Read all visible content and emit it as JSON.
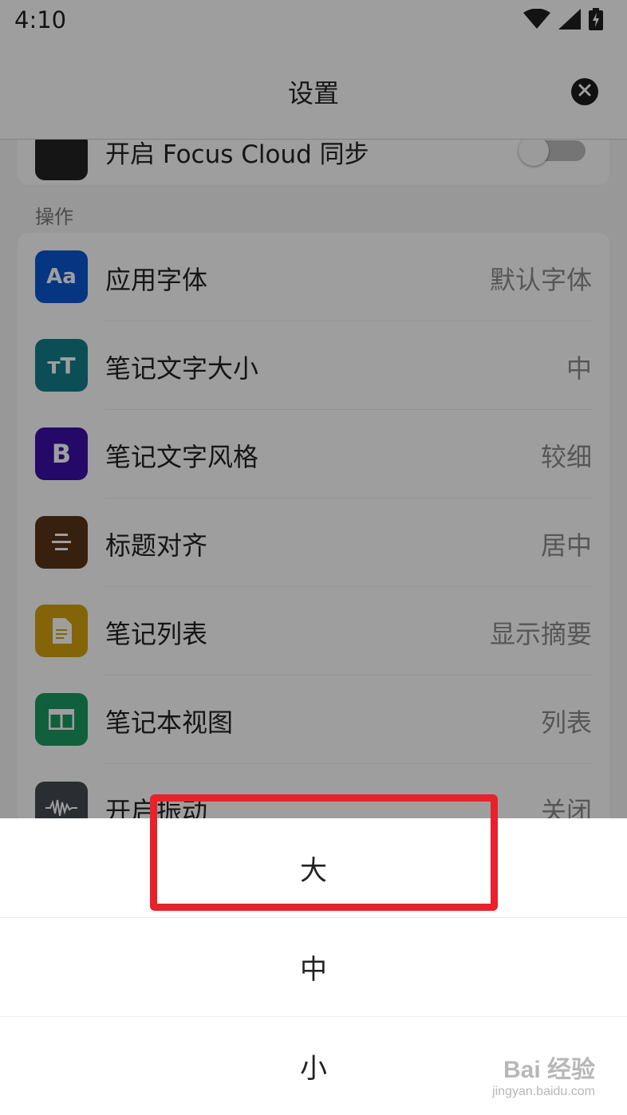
{
  "status_bar": {
    "time": "4:10",
    "icons": [
      "wifi-icon",
      "signal-icon",
      "battery-charging-icon"
    ]
  },
  "header": {
    "title": "设置",
    "close_icon": "close-circle-icon"
  },
  "sync_row": {
    "label": "开启 Focus Cloud 同步",
    "toggle_on": false
  },
  "section": {
    "label": "操作"
  },
  "rows": [
    {
      "label": "应用字体",
      "value": "默认字体",
      "icon": "font-aa-icon",
      "icon_text": "Aa",
      "color": "#0a56d1"
    },
    {
      "label": "笔记文字大小",
      "value": "中",
      "icon": "text-size-icon",
      "icon_text": "тT",
      "color": "#137f8c"
    },
    {
      "label": "笔记文字风格",
      "value": "较细",
      "icon": "bold-b-icon",
      "icon_text": "B",
      "color": "#3b0fa8"
    },
    {
      "label": "标题对齐",
      "value": "居中",
      "icon": "align-center-icon",
      "icon_text": "",
      "color": "#5a3518"
    },
    {
      "label": "笔记列表",
      "value": "显示摘要",
      "icon": "document-icon",
      "icon_text": "",
      "color": "#d4a20e"
    },
    {
      "label": "笔记本视图",
      "value": "列表",
      "icon": "columns-icon",
      "icon_text": "",
      "color": "#1b9a63"
    },
    {
      "label": "开启振动",
      "value": "关闭",
      "icon": "vibration-wave-icon",
      "icon_text": "",
      "color": "#444a52"
    }
  ],
  "sheet": {
    "options": [
      "大",
      "中",
      "小"
    ]
  },
  "highlight": {
    "color": "#e8212b"
  },
  "watermark": {
    "logo": "Bai 经验",
    "url": "jingyan.baidu.com"
  }
}
